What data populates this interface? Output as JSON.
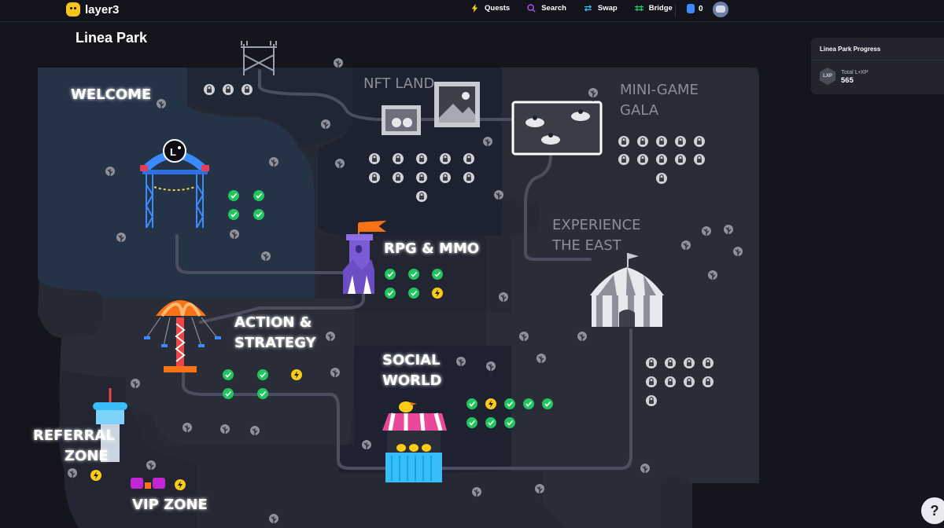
{
  "app": {
    "name": "layer3"
  },
  "nav": {
    "quests": "Quests",
    "search": "Search",
    "swap": "Swap",
    "bridge": "Bridge",
    "balance": "0"
  },
  "page": {
    "title": "Linea Park"
  },
  "regions": {
    "welcome": [
      "WELCOME"
    ],
    "nft_land": [
      "NFT LAND"
    ],
    "mini_game_gala": [
      "MINI-GAME",
      "GALA"
    ],
    "experience_the_east": [
      "EXPERIENCE",
      "THE EAST"
    ],
    "rpg_mmo": [
      "RPG & MMO"
    ],
    "action_strategy": [
      "ACTION &",
      "STRATEGY"
    ],
    "social_world": [
      "SOCIAL",
      "WORLD"
    ],
    "referral_zone": [
      "REFERRAL",
      "ZONE"
    ],
    "vip_zone": [
      "VIP ZONE"
    ]
  },
  "quest_status": {
    "top_locks": [
      "locked",
      "locked",
      "locked"
    ],
    "welcome": [
      "done",
      "done",
      "done",
      "done"
    ],
    "nft_land": [
      "locked",
      "locked",
      "locked",
      "locked",
      "locked",
      "locked",
      "locked",
      "locked",
      "locked",
      "locked",
      "locked"
    ],
    "mini_game_gala": [
      "locked",
      "locked",
      "locked",
      "locked",
      "locked",
      "locked",
      "locked",
      "locked",
      "locked",
      "locked",
      "locked"
    ],
    "rpg_mmo": [
      "done",
      "done",
      "done",
      "done",
      "done",
      "active"
    ],
    "action_strategy": [
      "done",
      "done",
      "active",
      "done",
      "done"
    ],
    "social_world": [
      "done",
      "active",
      "done",
      "done",
      "done",
      "done",
      "done",
      "done"
    ],
    "experience_the_east": [
      "locked",
      "locked",
      "locked",
      "locked",
      "locked",
      "locked",
      "locked",
      "locked",
      "locked"
    ],
    "referral_zone": [
      "active"
    ],
    "vip_zone": [
      "active"
    ]
  },
  "progress": {
    "title": "Linea Park Progress",
    "badge": "LXP",
    "total_label": "Total L•XP",
    "total_value": "565"
  },
  "help": {
    "label": "?"
  },
  "colors": {
    "background": "#15161d",
    "region_dark": "#1e2230",
    "region_welcome": "#253347",
    "region_mid": "#2a2c38",
    "done": "#21c55d",
    "active": "#facc15",
    "locked": "#d0d2d8"
  }
}
